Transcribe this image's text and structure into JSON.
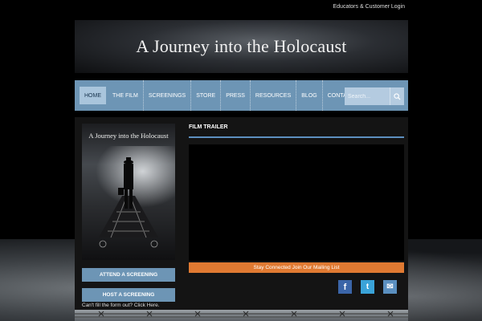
{
  "header": {
    "top_link": "Educators & Customer Login",
    "banner_title": "A Journey into the Holocaust"
  },
  "nav": {
    "items": [
      {
        "label": "HOME",
        "active": true
      },
      {
        "label": "THE FILM"
      },
      {
        "label": "SCREENINGS"
      },
      {
        "label": "STORE"
      },
      {
        "label": "PRESS"
      },
      {
        "label": "RESOURCES"
      },
      {
        "label": "BLOG"
      },
      {
        "label": "CONTACT"
      }
    ],
    "search_placeholder": "Search..."
  },
  "sidebar": {
    "poster_title": "A Journey into the Holocaust",
    "attend_label": "ATTEND A SCREENING",
    "host_label": "HOST A SCREENING",
    "form_note": "Can't fill the form out? Click Here."
  },
  "main": {
    "section_title": "FILM TRAILER",
    "mailing_label": "Stay Connected Join Our Mailing List"
  },
  "social": [
    {
      "name": "facebook-icon",
      "glyph": "f",
      "color": "#3b65a8"
    },
    {
      "name": "twitter-icon",
      "glyph": "t",
      "color": "#3aa3d8"
    },
    {
      "name": "email-icon",
      "glyph": "✉",
      "color": "#5a8fbf"
    }
  ],
  "colors": {
    "nav_blue": "#6d95b5",
    "accent_orange": "#e07a32",
    "rule_blue": "#5d8fc0"
  }
}
